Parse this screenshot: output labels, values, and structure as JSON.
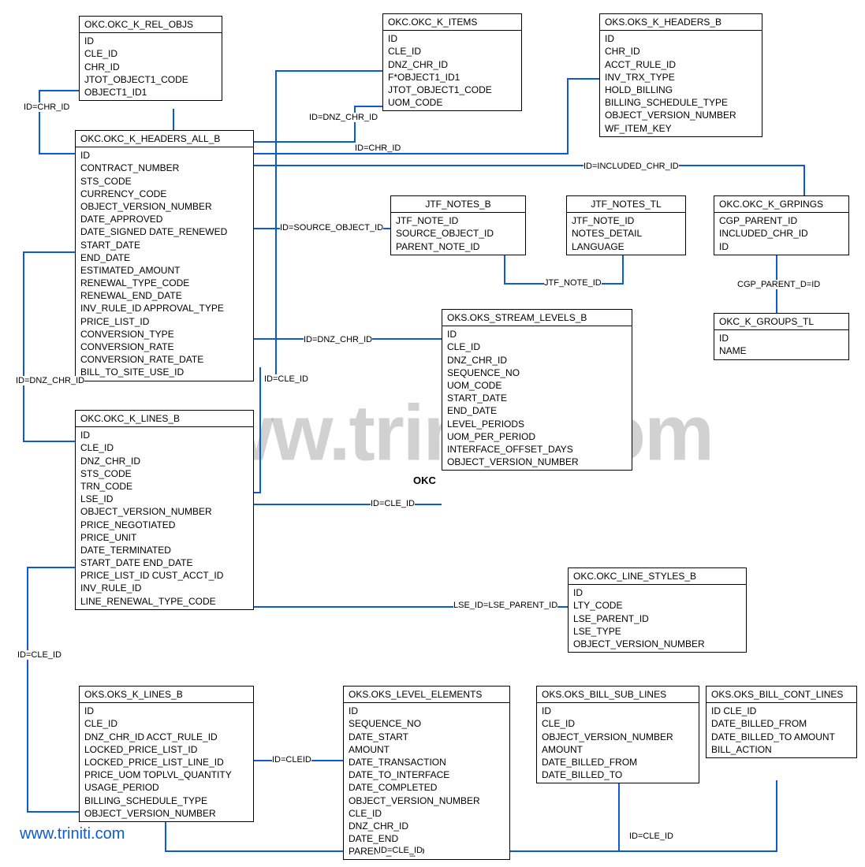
{
  "watermark": "www.triniti.com",
  "footer_url": "www.triniti.com",
  "okc_label": "OKC",
  "tables": {
    "okc_k_rel_objs": {
      "title": "OKC.OKC_K_REL_OBJS",
      "fields": [
        "ID",
        "CLE_ID",
        "CHR_ID",
        "JTOT_OBJECT1_CODE",
        "OBJECT1_ID1"
      ]
    },
    "okc_k_items": {
      "title": "OKC.OKC_K_ITEMS",
      "fields": [
        "ID",
        "CLE_ID",
        "DNZ_CHR_ID",
        "F*OBJECT1_ID1",
        "JTOT_OBJECT1_CODE",
        "UOM_CODE"
      ]
    },
    "oks_k_headers_b": {
      "title": "OKS.OKS_K_HEADERS_B",
      "fields": [
        "ID",
        "CHR_ID",
        "ACCT_RULE_ID",
        "INV_TRX_TYPE",
        "HOLD_BILLING",
        "BILLING_SCHEDULE_TYPE",
        "OBJECT_VERSION_NUMBER",
        "WF_ITEM_KEY"
      ]
    },
    "okc_k_headers_all_b": {
      "title": "OKC.OKC_K_HEADERS_ALL_B",
      "fields": [
        "ID",
        "CONTRACT_NUMBER",
        "STS_CODE",
        "CURRENCY_CODE",
        "OBJECT_VERSION_NUMBER",
        "DATE_APPROVED",
        "DATE_SIGNED DATE_RENEWED",
        "START_DATE",
        "END_DATE",
        "ESTIMATED_AMOUNT",
        "RENEWAL_TYPE_CODE",
        "RENEWAL_END_DATE",
        "INV_RULE_ID APPROVAL_TYPE",
        "PRICE_LIST_ID",
        "CONVERSION_TYPE",
        "CONVERSION_RATE",
        "CONVERSION_RATE_DATE",
        "BILL_TO_SITE_USE_ID"
      ]
    },
    "jtf_notes_b": {
      "title": "JTF_NOTES_B",
      "fields": [
        "JTF_NOTE_ID",
        "SOURCE_OBJECT_ID",
        "PARENT_NOTE_ID"
      ]
    },
    "jtf_notes_tl": {
      "title": "JTF_NOTES_TL",
      "fields": [
        "JTF_NOTE_ID",
        "NOTES_DETAIL",
        "LANGUAGE"
      ]
    },
    "okc_k_grpings": {
      "title": "OKC.OKC_K_GRPINGS",
      "fields": [
        "CGP_PARENT_ID",
        "INCLUDED_CHR_ID",
        "ID"
      ]
    },
    "okc_k_groups_tl": {
      "title": "OKC_K_GROUPS_TL",
      "fields": [
        "ID",
        "NAME"
      ]
    },
    "oks_stream_levels_b": {
      "title": "OKS.OKS_STREAM_LEVELS_B",
      "fields": [
        "ID",
        "CLE_ID",
        "DNZ_CHR_ID",
        "SEQUENCE_NO",
        "UOM_CODE",
        "START_DATE",
        "END_DATE",
        "LEVEL_PERIODS",
        "UOM_PER_PERIOD",
        "INTERFACE_OFFSET_DAYS",
        "OBJECT_VERSION_NUMBER"
      ]
    },
    "okc_k_lines_b": {
      "title": "OKC.OKC_K_LINES_B",
      "fields": [
        "ID",
        "CLE_ID",
        "DNZ_CHR_ID",
        "STS_CODE",
        "TRN_CODE",
        "LSE_ID",
        "OBJECT_VERSION_NUMBER",
        "PRICE_NEGOTIATED",
        "PRICE_UNIT",
        "DATE_TERMINATED",
        "START_DATE END_DATE",
        "PRICE_LIST_ID CUST_ACCT_ID",
        "INV_RULE_ID",
        "LINE_RENEWAL_TYPE_CODE"
      ]
    },
    "okc_line_styles_b": {
      "title": "OKC.OKC_LINE_STYLES_B",
      "fields": [
        "ID",
        "LTY_CODE",
        "LSE_PARENT_ID",
        "LSE_TYPE",
        "OBJECT_VERSION_NUMBER"
      ]
    },
    "oks_k_lines_b": {
      "title": "OKS.OKS_K_LINES_B",
      "fields": [
        "ID",
        "CLE_ID",
        "DNZ_CHR_ID ACCT_RULE_ID",
        "LOCKED_PRICE_LIST_ID",
        "LOCKED_PRICE_LIST_LINE_ID",
        "PRICE_UOM TOPLVL_QUANTITY",
        "USAGE_PERIOD",
        "BILLING_SCHEDULE_TYPE",
        "OBJECT_VERSION_NUMBER"
      ]
    },
    "oks_level_elements": {
      "title": "OKS.OKS_LEVEL_ELEMENTS",
      "fields": [
        "ID",
        "SEQUENCE_NO",
        "DATE_START",
        "AMOUNT",
        "DATE_TRANSACTION",
        "DATE_TO_INTERFACE",
        "DATE_COMPLETED",
        "OBJECT_VERSION_NUMBER",
        "CLE_ID",
        "DNZ_CHR_ID",
        "DATE_END",
        "PARENT_CLE_ID"
      ]
    },
    "oks_bill_sub_lines": {
      "title": "OKS.OKS_BILL_SUB_LINES",
      "fields": [
        "ID",
        "CLE_ID",
        "OBJECT_VERSION_NUMBER",
        "AMOUNT",
        "DATE_BILLED_FROM",
        "DATE_BILLED_TO"
      ]
    },
    "oks_bill_cont_lines": {
      "title": "OKS.OKS_BILL_CONT_LINES",
      "fields": [
        "ID CLE_ID",
        "DATE_BILLED_FROM",
        "DATE_BILLED_TO AMOUNT",
        "BILL_ACTION"
      ]
    }
  },
  "rel_labels": {
    "id_chr_id_1": "ID=CHR_ID",
    "id_dnz_chr_id_1": "ID=DNZ_CHR_ID",
    "id_chr_id_2": "ID=CHR_ID",
    "id_included_chr_id": "ID=INCLUDED_CHR_ID",
    "id_source_object_id": "ID=SOURCE_OBJECT_ID",
    "jtf_note_id": "JTF_NOTE_ID",
    "cgp_parent_d_id": "CGP_PARENT_D=ID",
    "id_dnz_chr_id_2": "ID=DNZ_CHR_ID",
    "id_cle_id_1": "ID=CLE_ID",
    "id_cle_id_2": "ID=CLE_ID",
    "id_dnz_chr_id_3": "ID=DNZ_CHR_ID",
    "lse_id_lse_parent_id": "LSE_ID=LSE_PARENT_ID",
    "id_cle_id_3": "ID=CLE_ID",
    "id_cleid": "ID=CLEID",
    "id_cle_id_4": "ID=CLE_ID",
    "id_cle_id_5": "ID=CLE_ID"
  }
}
